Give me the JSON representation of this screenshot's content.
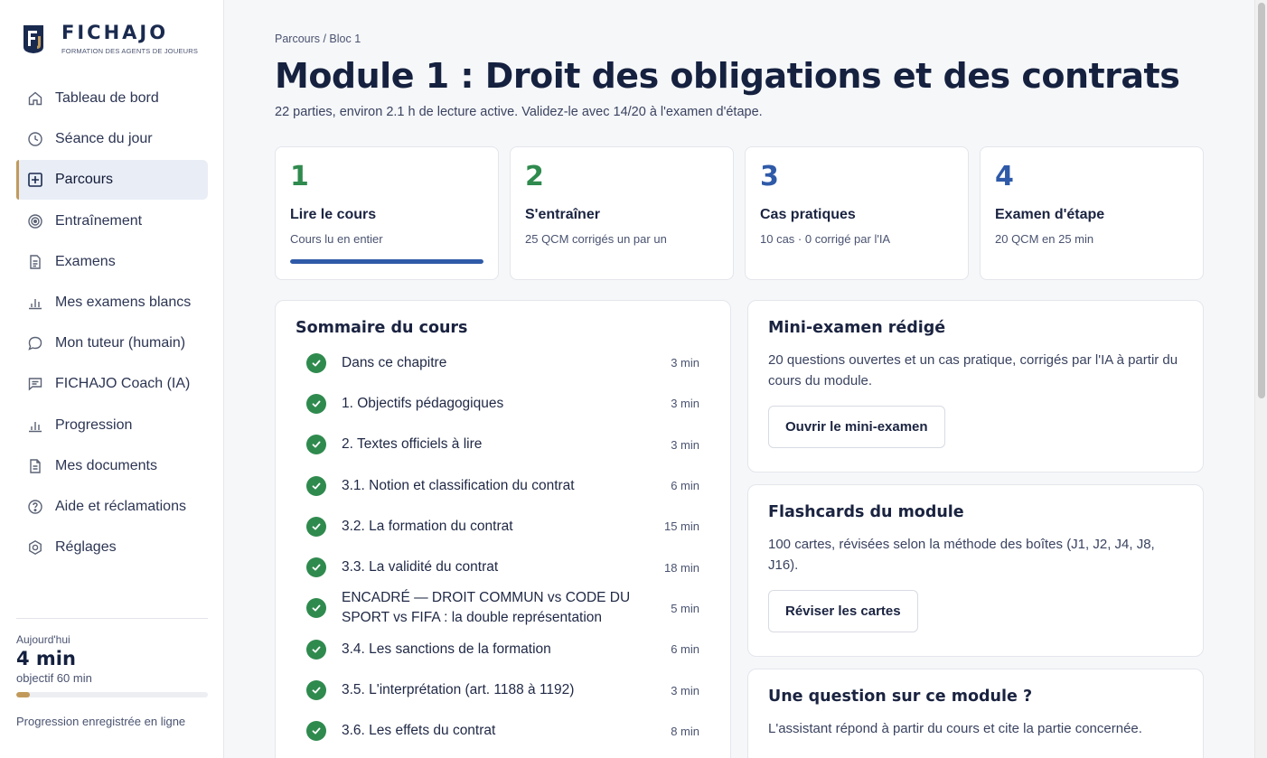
{
  "brand": {
    "name": "FICHAJO",
    "tagline": "FORMATION DES AGENTS DE JOUEURS"
  },
  "sidebar": {
    "items": [
      {
        "label": "Tableau de bord",
        "icon": "home-icon",
        "active": false
      },
      {
        "label": "Séance du jour",
        "icon": "clock-icon",
        "active": false
      },
      {
        "label": "Parcours",
        "icon": "path-grid-icon",
        "active": true
      },
      {
        "label": "Entraînement",
        "icon": "target-icon",
        "active": false
      },
      {
        "label": "Examens",
        "icon": "document-icon",
        "active": false
      },
      {
        "label": "Mes examens blancs",
        "icon": "bar-chart-icon",
        "active": false
      },
      {
        "label": "Mon tuteur (humain)",
        "icon": "chat-bubble-icon",
        "active": false
      },
      {
        "label": "FICHAJO Coach (IA)",
        "icon": "message-square-icon",
        "active": false
      },
      {
        "label": "Progression",
        "icon": "bar-chart-icon",
        "active": false
      },
      {
        "label": "Mes documents",
        "icon": "file-icon",
        "active": false
      },
      {
        "label": "Aide et réclamations",
        "icon": "help-circle-icon",
        "active": false
      },
      {
        "label": "Réglages",
        "icon": "settings-icon",
        "active": false
      }
    ],
    "today": {
      "label": "Aujourd'hui",
      "value": "4 min",
      "goal": "objectif 60 min",
      "progress": 0.07,
      "saved": "Progression enregistrée en ligne"
    }
  },
  "page": {
    "breadcrumb": "Parcours / Bloc 1",
    "title": "Module 1 : Droit des obligations et des contrats",
    "subtitle": "22 parties, environ 2.1 h de lecture active. Validez-le avec 14/20 à l'examen d'étape."
  },
  "steps": [
    {
      "num": "1",
      "title": "Lire le cours",
      "desc": "Cours lu en entier",
      "color": "#2f8a4e",
      "progress": 1.0
    },
    {
      "num": "2",
      "title": "S'entraîner",
      "desc": "25 QCM corrigés un par un",
      "color": "#2f8a4e"
    },
    {
      "num": "3",
      "title": "Cas pratiques",
      "desc": "10 cas · 0 corrigé par l'IA",
      "color": "#2f5aa8"
    },
    {
      "num": "4",
      "title": "Examen d'étape",
      "desc": "20 QCM en 25 min",
      "color": "#2f5aa8"
    }
  ],
  "toc": {
    "title": "Sommaire du cours",
    "items": [
      {
        "label": "Dans ce chapitre",
        "time": "3 min"
      },
      {
        "label": "1. Objectifs pédagogiques",
        "time": "3 min"
      },
      {
        "label": "2. Textes officiels à lire",
        "time": "3 min"
      },
      {
        "label": "3.1. Notion et classification du contrat",
        "time": "6 min"
      },
      {
        "label": "3.2. La formation du contrat",
        "time": "15 min"
      },
      {
        "label": "3.3. La validité du contrat",
        "time": "18 min"
      },
      {
        "label": "ENCADRÉ — DROIT COMMUN vs CODE DU SPORT vs FIFA : la double représentation",
        "time": "5 min"
      },
      {
        "label": "3.4. Les sanctions de la formation",
        "time": "6 min"
      },
      {
        "label": "3.5. L'interprétation (art. 1188 à 1192)",
        "time": "3 min"
      },
      {
        "label": "3.6. Les effets du contrat",
        "time": "8 min"
      }
    ]
  },
  "cards": {
    "mini_exam": {
      "title": "Mini-examen rédigé",
      "text": "20 questions ouvertes et un cas pratique, corrigés par l'IA à partir du cours du module.",
      "button": "Ouvrir le mini-examen"
    },
    "flashcards": {
      "title": "Flashcards du module",
      "text": "100 cartes, révisées selon la méthode des boîtes (J1, J2, J4, J8, J16).",
      "button": "Réviser les cartes"
    },
    "question": {
      "title": "Une question sur ce module ?",
      "text": "L'assistant répond à partir du cours et cite la partie concernée."
    }
  }
}
